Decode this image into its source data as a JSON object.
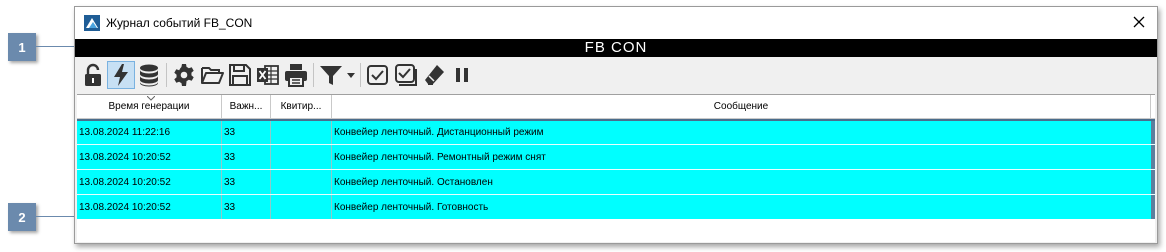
{
  "callouts": [
    {
      "label": "1"
    },
    {
      "label": "2"
    }
  ],
  "window": {
    "title": "Журнал событий FB_CON",
    "header_caption": "FB  CON"
  },
  "toolbar": {
    "buttons": [
      {
        "name": "lock-icon"
      },
      {
        "name": "lightning-icon",
        "active": true
      },
      {
        "name": "database-icon"
      },
      {
        "name": "gear-icon"
      },
      {
        "name": "folder-open-icon"
      },
      {
        "name": "save-icon"
      },
      {
        "name": "excel-icon"
      },
      {
        "name": "print-icon"
      },
      {
        "name": "filter-icon"
      },
      {
        "name": "checkbox-icon"
      },
      {
        "name": "checkbox-all-icon"
      },
      {
        "name": "eraser-icon"
      },
      {
        "name": "pause-icon"
      }
    ]
  },
  "table": {
    "columns": [
      "Время генерации",
      "Важн...",
      "Квитир...",
      "Сообщение"
    ],
    "rows": [
      {
        "time": "13.08.2024 11:22:16",
        "priority": "33",
        "ack": "",
        "message": "Конвейер ленточный. Дистанционный режим"
      },
      {
        "time": "13.08.2024 10:20:52",
        "priority": "33",
        "ack": "",
        "message": "Конвейер ленточный. Ремонтный режим снят"
      },
      {
        "time": "13.08.2024 10:20:52",
        "priority": "33",
        "ack": "",
        "message": "Конвейер ленточный. Остановлен"
      },
      {
        "time": "13.08.2024 10:20:52",
        "priority": "33",
        "ack": "",
        "message": "Конвейер ленточный. Готовность"
      }
    ]
  },
  "colors": {
    "row_bg": "#00ffff",
    "header_bar": "#000000",
    "callout": "#6b8aad"
  }
}
